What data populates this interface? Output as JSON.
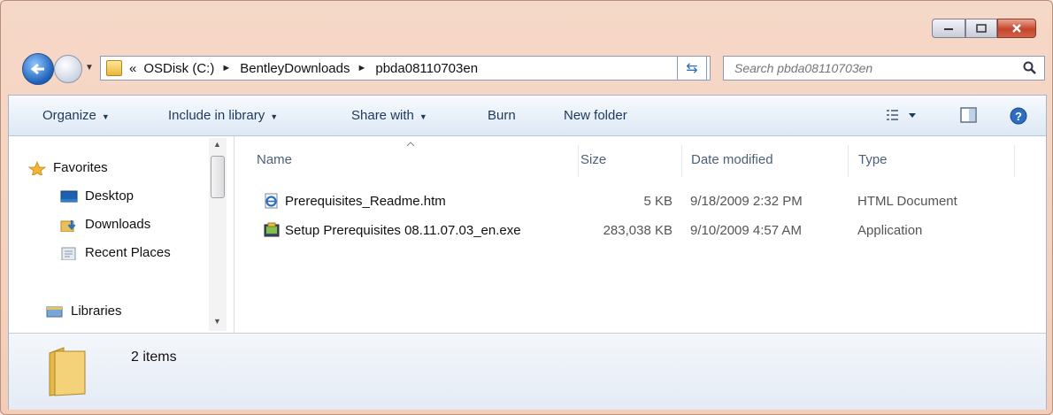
{
  "window": {
    "controls": {
      "minimize_icon": "minimize-icon",
      "maximize_icon": "maximize-icon",
      "close_icon": "close-icon"
    }
  },
  "address_bar": {
    "overflow": "«",
    "crumbs": [
      "OSDisk (C:)",
      "BentleyDownloads",
      "pbda08110703en"
    ]
  },
  "search": {
    "placeholder": "Search pbda08110703en"
  },
  "toolbar": {
    "organize": "Organize",
    "include_in_library": "Include in library",
    "share_with": "Share with",
    "burn": "Burn",
    "new_folder": "New folder"
  },
  "nav_pane": {
    "favorites": "Favorites",
    "items": [
      "Desktop",
      "Downloads",
      "Recent Places"
    ],
    "libraries": "Libraries"
  },
  "file_list": {
    "columns": {
      "name": "Name",
      "size": "Size",
      "date_modified": "Date modified",
      "type": "Type"
    },
    "rows": [
      {
        "name": "Prerequisites_Readme.htm",
        "size": "5 KB",
        "date": "9/18/2009 2:32 PM",
        "type": "HTML Document",
        "icon": "html-document-icon"
      },
      {
        "name": "Setup Prerequisites 08.11.07.03_en.exe",
        "size": "283,038 KB",
        "date": "9/10/2009 4:57 AM",
        "type": "Application",
        "icon": "setup-exe-icon"
      }
    ]
  },
  "details": {
    "item_count": "2 items"
  },
  "colors": {
    "frame": "#f3cdb9",
    "toolbar_text": "#1e395b",
    "close_button": "#c4452b"
  }
}
